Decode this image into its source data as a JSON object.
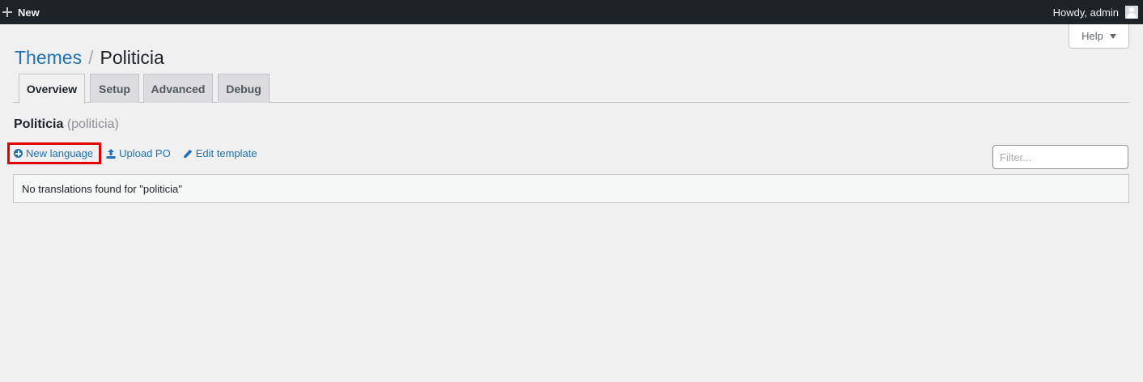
{
  "adminbar": {
    "new_label": "New",
    "account_label": "Howdy, admin"
  },
  "help": {
    "label": "Help"
  },
  "heading": {
    "parent": "Themes",
    "separator": "/",
    "current": "Politicia"
  },
  "tabs": [
    {
      "label": "Overview",
      "active": true
    },
    {
      "label": "Setup",
      "active": false
    },
    {
      "label": "Advanced",
      "active": false
    },
    {
      "label": "Debug",
      "active": false
    }
  ],
  "project": {
    "name": "Politicia",
    "slug": "(politicia)"
  },
  "actions": {
    "new_language": "New language",
    "upload_po": "Upload PO",
    "edit_template": "Edit template"
  },
  "filter": {
    "placeholder": "Filter..."
  },
  "notice": {
    "text": "No translations found for \"politicia\""
  },
  "colors": {
    "link": "#2271b1",
    "highlight_border": "#e00000",
    "adminbar_bg": "#1d2327",
    "page_bg": "#f0f0f1"
  }
}
